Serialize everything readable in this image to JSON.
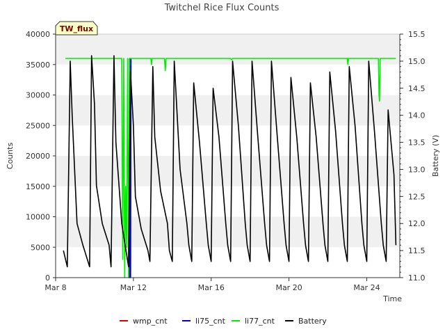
{
  "chart_data": {
    "type": "line",
    "title": "Twitchel Rice Flux Counts",
    "site_badge": "TW_flux",
    "xlabel": "Time",
    "ylabel": "Counts",
    "y2label": "Battery (V)",
    "xlim": [
      "2021-03-08",
      "2021-03-25.7"
    ],
    "x_ticks": [
      {
        "value": "2021-03-08",
        "label": "Mar 8"
      },
      {
        "value": "2021-03-12",
        "label": "Mar 12"
      },
      {
        "value": "2021-03-16",
        "label": "Mar 16"
      },
      {
        "value": "2021-03-20",
        "label": "Mar 20"
      },
      {
        "value": "2021-03-24",
        "label": "Mar 24"
      }
    ],
    "ylim": [
      0,
      40000
    ],
    "y_ticks": [
      0,
      5000,
      10000,
      15000,
      20000,
      25000,
      30000,
      35000,
      40000
    ],
    "y2lim": [
      11.0,
      15.5
    ],
    "y2_ticks": [
      "11.0",
      "11.5",
      "12.0",
      "12.5",
      "13.0",
      "13.5",
      "14.0",
      "14.5",
      "15.0",
      "15.5"
    ],
    "grid": "horizontal bands",
    "legend_position": "bottom",
    "series": [
      {
        "name": "wmp_cnt",
        "color": "#dd0000",
        "axis": "left",
        "x": [
          "2021-03-11T12:00",
          "2021-03-11T12:30"
        ],
        "y": [
          36000,
          36000
        ]
      },
      {
        "name": "li75_cnt",
        "color": "#0000cc",
        "axis": "left",
        "x": [
          "2021-03-11T19:00",
          "2021-03-11T19:20",
          "2021-03-11T19:40",
          "2021-03-11T20:00",
          "2021-03-11T20:30",
          "2021-03-11T21:00"
        ],
        "y": [
          36000,
          0,
          36000,
          36000,
          0,
          36000
        ]
      },
      {
        "name": "li77_cnt",
        "color": "#00ee00",
        "axis": "left",
        "x": [
          "2021-03-08.5",
          "2021-03-11.4",
          "2021-03-11.45",
          "2021-03-11.5",
          "2021-03-11.55",
          "2021-03-11.6",
          "2021-03-11.65",
          "2021-03-11.7",
          "2021-03-11.75",
          "2021-03-11.8",
          "2021-03-12.3",
          "2021-03-12.9",
          "2021-03-12.93",
          "2021-03-12.96",
          "2021-03-13.6",
          "2021-03-13.64",
          "2021-03-13.68",
          "2021-03-17.0",
          "2021-03-17.05",
          "2021-03-17.1",
          "2021-03-23.0",
          "2021-03-23.03",
          "2021-03-23.06",
          "2021-03-24.6",
          "2021-03-24.63",
          "2021-03-24.66",
          "2021-03-24.69",
          "2021-03-24.72",
          "2021-03-25.5"
        ],
        "y": [
          36000,
          36000,
          3000,
          36000,
          0,
          15000,
          5000,
          36000,
          0,
          36000,
          36000,
          36000,
          35000,
          36000,
          36000,
          34000,
          36000,
          36000,
          35800,
          36000,
          36000,
          35000,
          36000,
          36000,
          30000,
          29000,
          36000,
          36000,
          36000
        ]
      },
      {
        "name": "Battery",
        "color": "#000000",
        "axis": "right",
        "x": [
          "2021-03-08.4",
          "2021-03-08.6",
          "2021-03-08.75",
          "2021-03-08.85",
          "2021-03-09.0",
          "2021-03-09.1",
          "2021-03-09.4",
          "2021-03-09.75",
          "2021-03-09.85",
          "2021-03-10.0",
          "2021-03-10.1",
          "2021-03-10.4",
          "2021-03-10.75",
          "2021-03-10.85",
          "2021-03-11.0",
          "2021-03-11.1",
          "2021-03-11.4",
          "2021-03-11.75",
          "2021-03-11.85",
          "2021-03-12.0",
          "2021-03-12.1",
          "2021-03-12.4",
          "2021-03-12.75",
          "2021-03-12.85",
          "2021-03-13.0",
          "2021-03-13.1",
          "2021-03-13.4",
          "2021-03-13.75",
          "2021-03-13.85",
          "2021-03-14.0",
          "2021-03-14.1",
          "2021-03-14.4",
          "2021-03-14.75",
          "2021-03-14.85",
          "2021-03-15.0",
          "2021-03-15.1",
          "2021-03-15.4",
          "2021-03-15.75",
          "2021-03-15.85",
          "2021-03-16.0",
          "2021-03-16.1",
          "2021-03-16.4",
          "2021-03-16.75",
          "2021-03-16.85",
          "2021-03-17.0",
          "2021-03-17.1",
          "2021-03-17.4",
          "2021-03-17.75",
          "2021-03-17.85",
          "2021-03-18.0",
          "2021-03-18.1",
          "2021-03-18.4",
          "2021-03-18.75",
          "2021-03-18.85",
          "2021-03-19.0",
          "2021-03-19.1",
          "2021-03-19.4",
          "2021-03-19.75",
          "2021-03-19.85",
          "2021-03-20.0",
          "2021-03-20.1",
          "2021-03-20.4",
          "2021-03-20.75",
          "2021-03-20.85",
          "2021-03-21.0",
          "2021-03-21.1",
          "2021-03-21.4",
          "2021-03-21.75",
          "2021-03-21.85",
          "2021-03-22.0",
          "2021-03-22.1",
          "2021-03-22.4",
          "2021-03-22.75",
          "2021-03-22.85",
          "2021-03-23.0",
          "2021-03-23.1",
          "2021-03-23.4",
          "2021-03-23.75",
          "2021-03-23.85",
          "2021-03-24.0",
          "2021-03-24.1",
          "2021-03-24.4",
          "2021-03-24.75",
          "2021-03-24.85",
          "2021-03-25.0",
          "2021-03-25.1",
          "2021-03-25.4",
          "2021-03-25.5"
        ],
        "y": [
          11.5,
          11.2,
          15.0,
          14.0,
          12.8,
          12.0,
          11.6,
          11.2,
          15.1,
          14.2,
          12.7,
          12.0,
          11.6,
          11.2,
          15.1,
          13.5,
          12.0,
          11.2,
          14.8,
          13.8,
          12.5,
          11.9,
          11.5,
          11.3,
          14.9,
          13.6,
          12.6,
          12.0,
          11.5,
          11.3,
          15.0,
          13.0,
          12.0,
          11.6,
          11.3,
          14.6,
          13.5,
          12.0,
          11.6,
          11.3,
          14.5,
          13.6,
          12.0,
          11.6,
          11.3,
          15.0,
          13.8,
          12.0,
          11.6,
          11.3,
          15.0,
          13.6,
          12.0,
          11.6,
          11.3,
          15.0,
          13.6,
          12.0,
          11.6,
          11.3,
          14.7,
          13.6,
          12.0,
          11.6,
          11.3,
          14.6,
          13.6,
          12.0,
          11.6,
          11.3,
          14.8,
          13.7,
          12.0,
          11.6,
          11.3,
          14.9,
          13.8,
          12.0,
          11.6,
          11.3,
          15.0,
          13.7,
          12.0,
          11.6,
          11.3,
          14.1,
          12.9,
          11.6
        ]
      }
    ]
  }
}
